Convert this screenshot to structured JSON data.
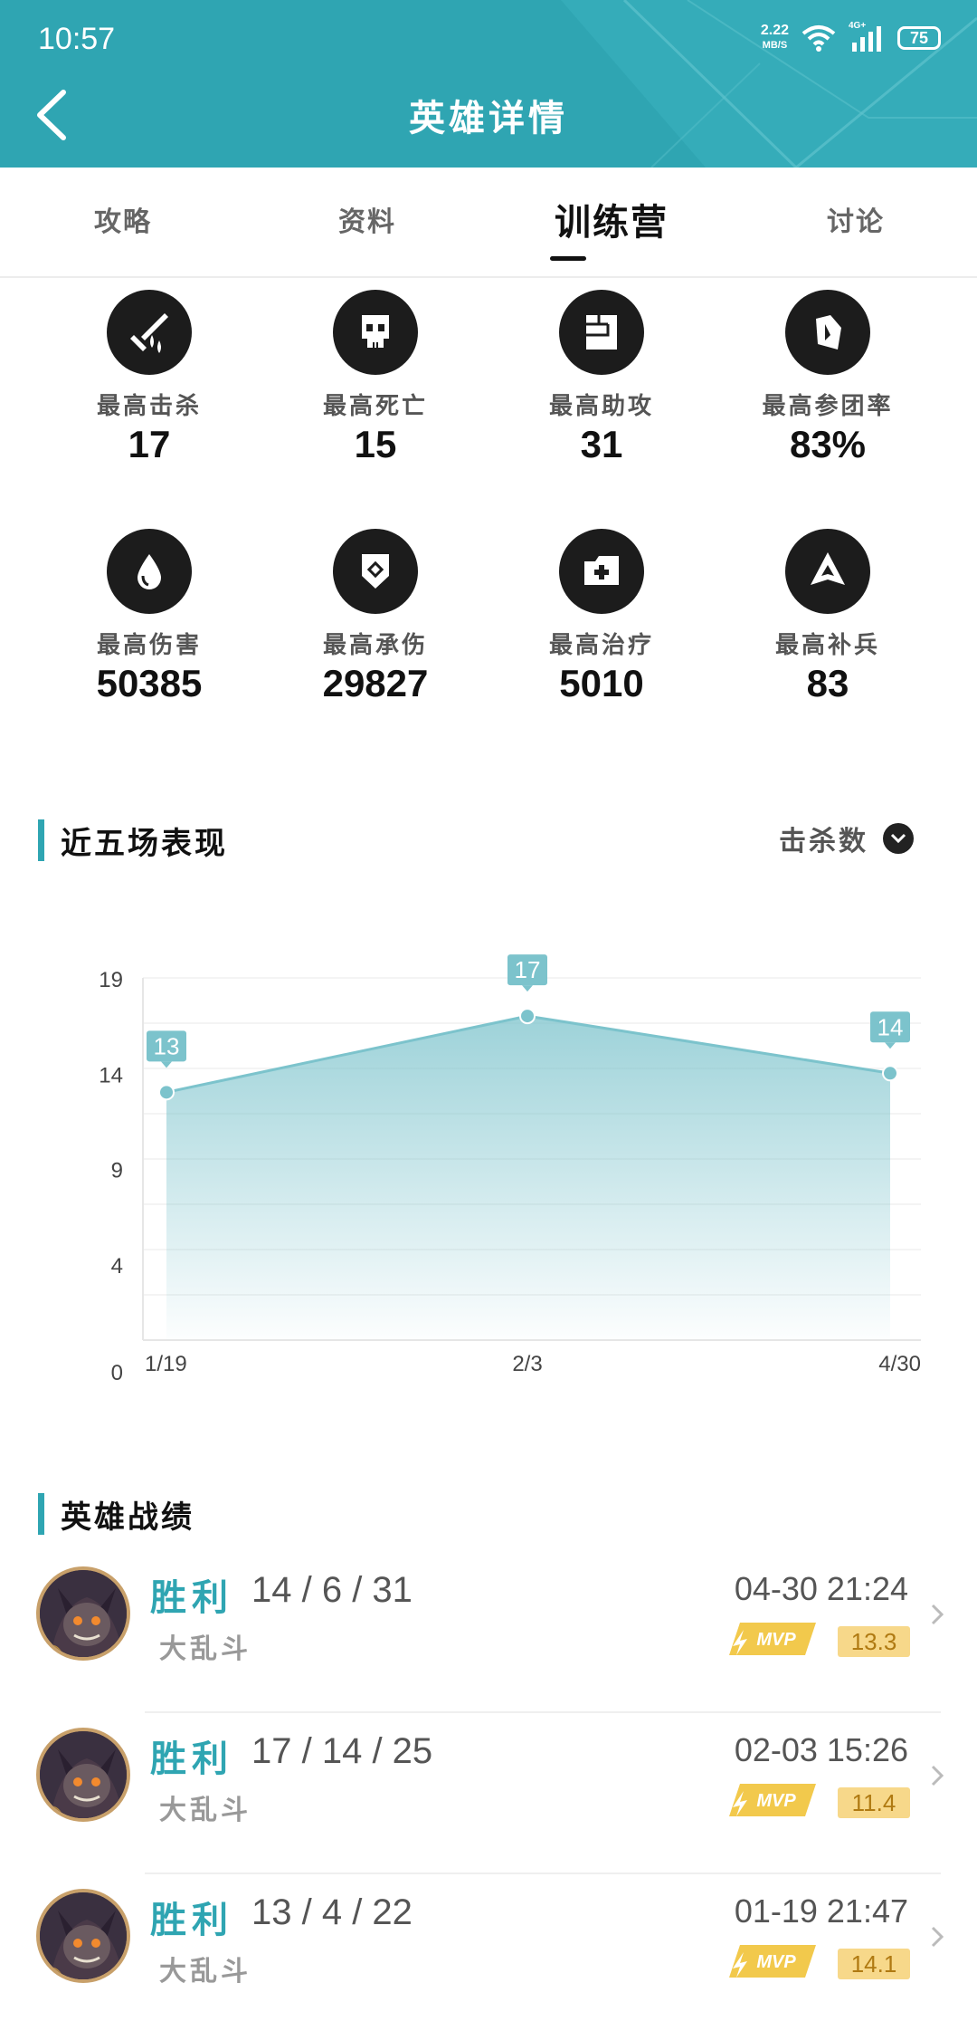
{
  "status_bar": {
    "time": "10:57",
    "net_speed_value": "2.22",
    "net_speed_unit": "MB/S",
    "network": "4G+",
    "battery": "75"
  },
  "header": {
    "title": "英雄详情"
  },
  "tabs": [
    {
      "label": "攻略"
    },
    {
      "label": "资料"
    },
    {
      "label": "训练营",
      "active": true
    },
    {
      "label": "讨论"
    }
  ],
  "stats": [
    {
      "label": "最高击杀",
      "value": "17",
      "icon": "sword-icon"
    },
    {
      "label": "最高死亡",
      "value": "15",
      "icon": "skull-icon"
    },
    {
      "label": "最高助攻",
      "value": "31",
      "icon": "fist-icon"
    },
    {
      "label": "最高参团率",
      "value": "83%",
      "icon": "shield-fist-icon"
    },
    {
      "label": "最高伤害",
      "value": "50385",
      "icon": "blood-drop-icon"
    },
    {
      "label": "最高承伤",
      "value": "29827",
      "icon": "shield-icon"
    },
    {
      "label": "最高治疗",
      "value": "5010",
      "icon": "medkit-icon"
    },
    {
      "label": "最高补兵",
      "value": "83",
      "icon": "tower-icon"
    }
  ],
  "performance": {
    "title": "近五场表现",
    "dropdown_label": "击杀数"
  },
  "chart_data": {
    "type": "area",
    "x": [
      "1/19",
      "2/3",
      "4/30"
    ],
    "values": [
      13,
      17,
      14
    ],
    "yticks": [
      0,
      4,
      9,
      14,
      19
    ],
    "ylim": [
      0,
      19
    ],
    "grid": true,
    "color": "#7cc3cc"
  },
  "records_section": {
    "title": "英雄战绩"
  },
  "records": [
    {
      "result": "胜利",
      "kda": "14 / 6 / 31",
      "mode": "大乱斗",
      "time": "04-30 21:24",
      "mvp": "MVP",
      "score": "13.3"
    },
    {
      "result": "胜利",
      "kda": "17 / 14 / 25",
      "mode": "大乱斗",
      "time": "02-03 15:26",
      "mvp": "MVP",
      "score": "11.4"
    },
    {
      "result": "胜利",
      "kda": "13 / 4 / 22",
      "mode": "大乱斗",
      "time": "01-19 21:47",
      "mvp": "MVP",
      "score": "14.1"
    }
  ]
}
